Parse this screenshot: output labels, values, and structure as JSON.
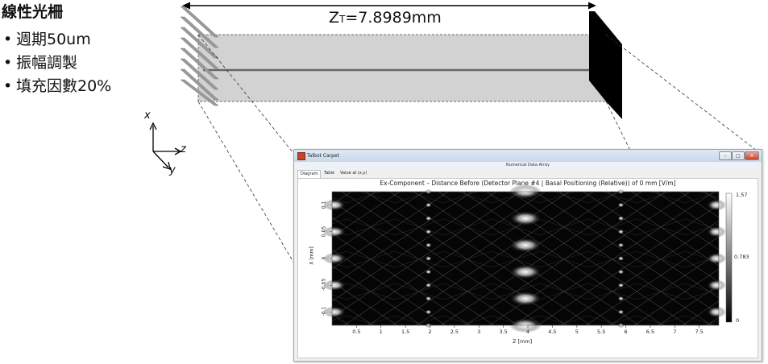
{
  "text": {
    "title": "線性光柵",
    "bullets": [
      "週期50um",
      "振幅調製",
      "填充因數20%"
    ],
    "zt_label_main": "Z",
    "zt_label_sub": "T",
    "zt_label_value": "=7.8989mm",
    "axis_x": "x",
    "axis_z": "z",
    "axis_y": "y"
  },
  "window": {
    "app_title": "Talbot Carpet",
    "subtitle": "Numerical Data Array",
    "tabs": [
      "Diagram",
      "Table",
      "Value at (x,y)"
    ],
    "buttons": {
      "minimize": "–",
      "maximize": "□",
      "close": "✕"
    },
    "colors": {
      "accent": "#c7442c"
    }
  },
  "chart_data": {
    "type": "heatmap",
    "title": "Ex-Component – Distance Before (Detector Plane #4 | Basal Positioning (Relative)) of 0 mm   [V/m]",
    "xlabel": "Z [mm]",
    "ylabel": "X [mm]",
    "xlim": [
      0,
      7.9
    ],
    "ylim": [
      -0.125,
      0.125
    ],
    "xticks": [
      "0.5",
      "1",
      "1.5",
      "2",
      "2.5",
      "3",
      "3.5",
      "4",
      "4.5",
      "5",
      "5.5",
      "6",
      "6.5",
      "7",
      "7.5"
    ],
    "yticks": [
      "0.1",
      "0.05",
      "0",
      "-0.05",
      "-0.1"
    ],
    "colorbar_ticks": [
      "1.57",
      "0.783",
      "0"
    ],
    "colormap": "grayscale"
  }
}
